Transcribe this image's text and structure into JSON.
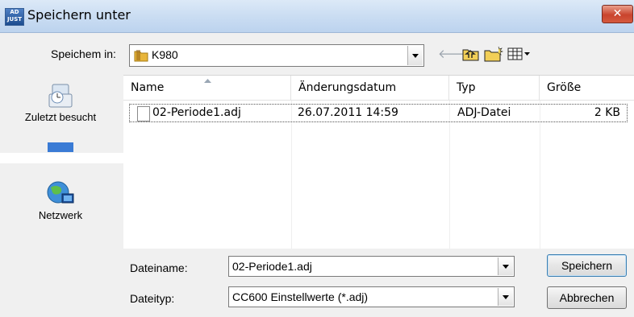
{
  "window": {
    "title": "Speichern unter",
    "app_icon_text": "AD\nJUST",
    "close_glyph": "✕"
  },
  "toolbar": {
    "save_in_label": "Speichem in:",
    "location": "K980",
    "icons": [
      "back-arrow-icon",
      "up-folder-icon",
      "new-folder-icon",
      "view-menu-icon"
    ]
  },
  "sidebar": {
    "items": [
      {
        "label": "Zuletzt besucht",
        "icon": "recent-places-icon"
      },
      {
        "label": "",
        "icon": "desktop-icon"
      },
      {
        "label": "Netzwerk",
        "icon": "network-icon"
      }
    ]
  },
  "file_list": {
    "columns": [
      "Name",
      "Änderungsdatum",
      "Typ",
      "Größe"
    ],
    "sort_indicator": "ascending",
    "rows": [
      {
        "name": "02-Periode1.adj",
        "date": "26.07.2011 14:59",
        "type": "ADJ-Datei",
        "size": "2 KB"
      }
    ]
  },
  "footer": {
    "filename_label": "Dateiname:",
    "filename_value": "02-Periode1.adj",
    "filetype_label": "Dateityp:",
    "filetype_value": "CC600 Einstellwerte (*.adj)",
    "save_button": "Speichern",
    "cancel_button": "Abbrechen"
  },
  "colors": {
    "titlebar": "#c9dcf2",
    "dialog_bg": "#f0f0f0",
    "close_button": "#c9442d",
    "folder": "#e8b53a"
  }
}
